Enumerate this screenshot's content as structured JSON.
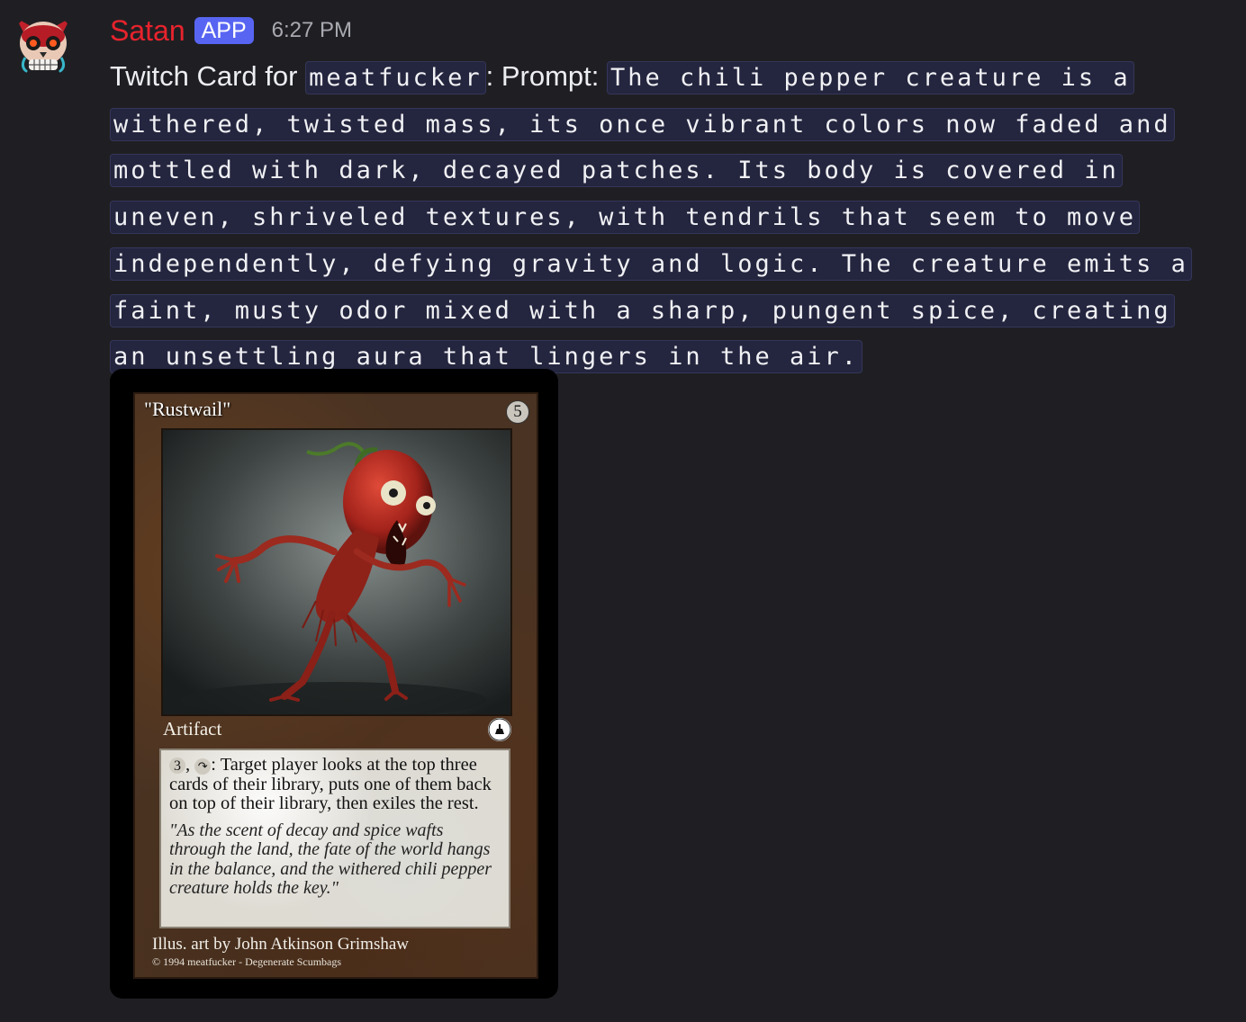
{
  "author": {
    "username": "Satan",
    "badge": "APP",
    "timestamp": "6:27 PM",
    "avatar_icon": "demon-skull-icon"
  },
  "message": {
    "text_before": "Twitch Card for ",
    "user_code": "meatfucker",
    "text_middle": ": Prompt: ",
    "prompt_code": "The chili pepper creature is a withered, twisted mass, its once vibrant colors now faded and mottled with dark, decayed patches. Its body is covered in uneven, shriveled textures, with tendrils that seem to move independently, defying gravity and logic. The creature emits a faint, musty odor mixed with a sharp, pungent spice, creating an unsettling aura that lingers in the air."
  },
  "card": {
    "name": "\"Rustwail\"",
    "mana_cost": "5",
    "type_line": "Artifact",
    "rules_text": {
      "cost": "3",
      "tap_symbol": "tap-icon",
      "ability": ": Target player looks at the top three cards of their library, puts one of them back on top of their library, then exiles the rest."
    },
    "flavor_text": "\"As the scent of decay and spice wafts through the land, the fate of the world hangs in the balance, and the withered chili pepper creature holds the key.\"",
    "illustrator": "Illus. art by John Atkinson Grimshaw",
    "copyright": "© 1994 meatfucker - Degenerate Scumbags",
    "art_subject": "chili-pepper-creature-illustration"
  },
  "colors": {
    "username": "#e8232d",
    "badge_bg": "#5865f2",
    "background": "#1f1f23"
  }
}
